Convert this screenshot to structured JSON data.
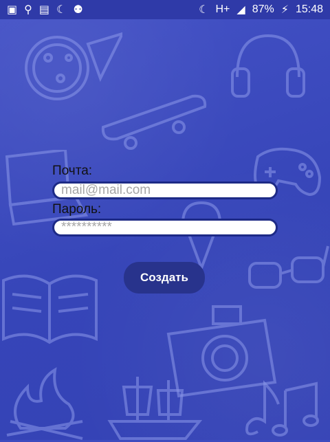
{
  "status_bar": {
    "battery": "87%",
    "time": "15:48",
    "network": "H+"
  },
  "form": {
    "email_label": "Почта:",
    "email_placeholder": "mail@mail.com",
    "password_label": "Пароль:",
    "password_placeholder": "**********",
    "create_button": "Создать"
  },
  "icons": [
    "gallery-icon",
    "usb-icon",
    "sd-card-icon",
    "moon-icon",
    "android-icon",
    "battery-charging-icon",
    "signal-icon"
  ]
}
